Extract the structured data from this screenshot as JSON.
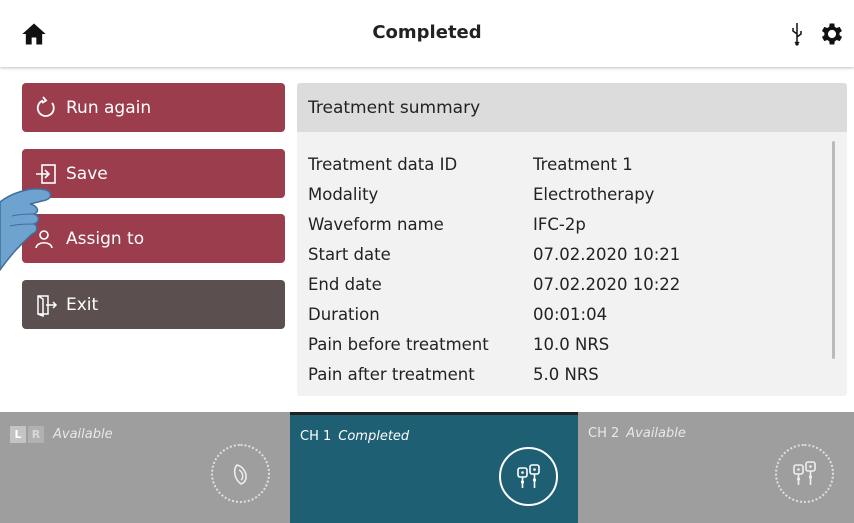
{
  "header": {
    "title": "Completed",
    "home_icon": "home-icon",
    "usb_icon": "usb-icon",
    "settings_icon": "gear-icon"
  },
  "actions": {
    "run_again": "Run again",
    "save": "Save",
    "assign_to": "Assign to",
    "exit": "Exit"
  },
  "summary": {
    "title": "Treatment summary",
    "rows": [
      {
        "label": "Treatment data ID",
        "value": "Treatment 1"
      },
      {
        "label": "Modality",
        "value": "Electrotherapy"
      },
      {
        "label": "Waveform name",
        "value": "IFC-2p"
      },
      {
        "label": "Start date",
        "value": "07.02.2020 10:21"
      },
      {
        "label": "End date",
        "value": "07.02.2020 10:22"
      },
      {
        "label": "Duration",
        "value": "00:01:04"
      },
      {
        "label": "Pain before treatment",
        "value": "10.0 NRS"
      },
      {
        "label": "Pain after treatment",
        "value": "5.0 NRS"
      }
    ]
  },
  "channels": [
    {
      "name": "",
      "l": "L",
      "r": "R",
      "status": "Available"
    },
    {
      "name": "CH 1",
      "status": "Completed"
    },
    {
      "name": "CH 2",
      "status": "Available"
    }
  ],
  "colors": {
    "primary_button": "#9c3d4d",
    "exit_button": "#5c4f50",
    "active_channel": "#1f5f74",
    "inactive_channel": "#9e9e9e"
  }
}
